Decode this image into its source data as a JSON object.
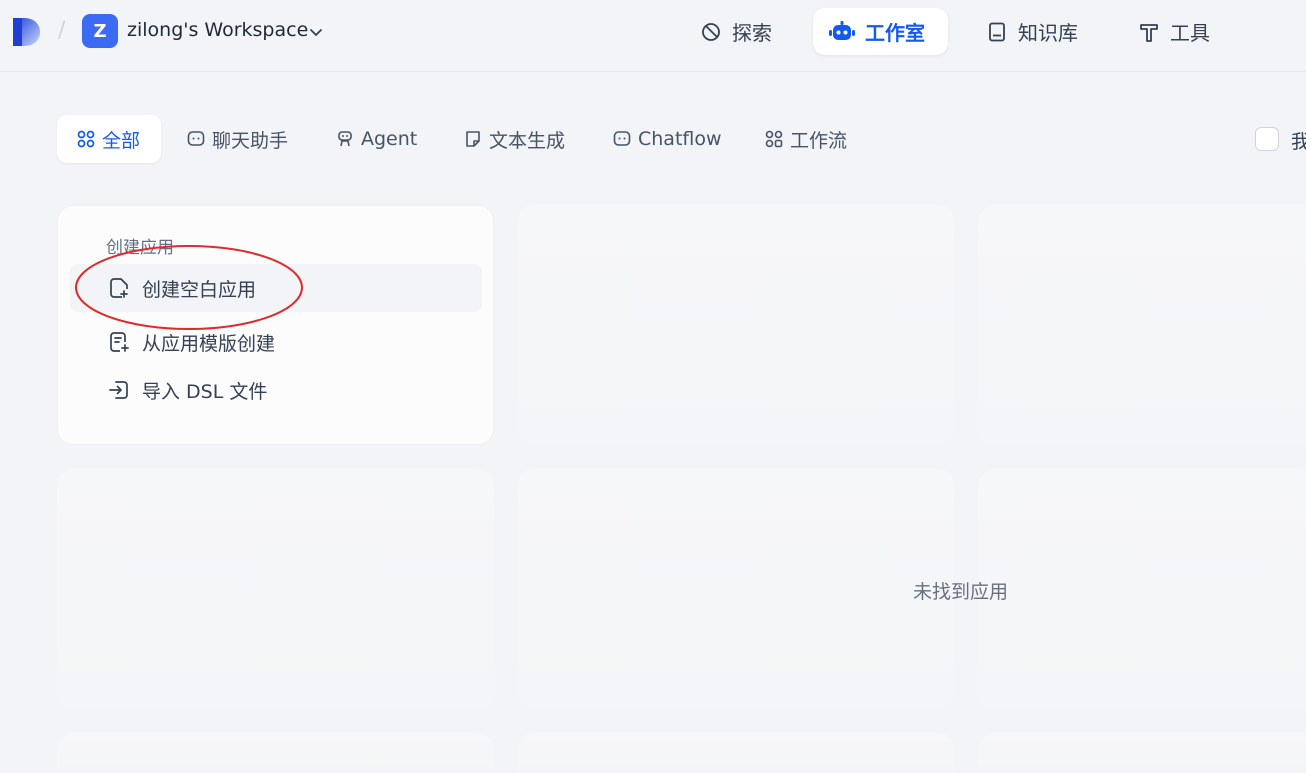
{
  "header": {
    "workspace_initial": "Z",
    "workspace_name": "zilong's Workspace",
    "nav": [
      {
        "label": "探索",
        "icon": "compass-icon",
        "active": false
      },
      {
        "label": "工作室",
        "icon": "robot-icon",
        "active": true
      },
      {
        "label": "知识库",
        "icon": "book-icon",
        "active": false
      },
      {
        "label": "工具",
        "icon": "hammer-icon",
        "active": false
      }
    ]
  },
  "tabs": [
    {
      "label": "全部",
      "icon": "grid-icon",
      "active": true
    },
    {
      "label": "聊天助手",
      "icon": "chat-bubble-icon",
      "active": false
    },
    {
      "label": "Agent",
      "icon": "agent-icon",
      "active": false
    },
    {
      "label": "文本生成",
      "icon": "document-icon",
      "active": false
    },
    {
      "label": "Chatflow",
      "icon": "chat-bubble-icon",
      "active": false
    },
    {
      "label": "工作流",
      "icon": "workflow-icon",
      "active": false
    }
  ],
  "filter": {
    "mine_label": "我"
  },
  "create_panel": {
    "title": "创建应用",
    "items": [
      {
        "label": "创建空白应用",
        "icon": "file-plus-icon"
      },
      {
        "label": "从应用模版创建",
        "icon": "template-icon"
      },
      {
        "label": "导入 DSL 文件",
        "icon": "import-icon"
      }
    ]
  },
  "empty_state": "未找到应用",
  "colors": {
    "accent": "#155aef",
    "workspace_badge": "#3b6bf3",
    "annotation": "#e02b2b",
    "background": "#f2f4f7"
  }
}
